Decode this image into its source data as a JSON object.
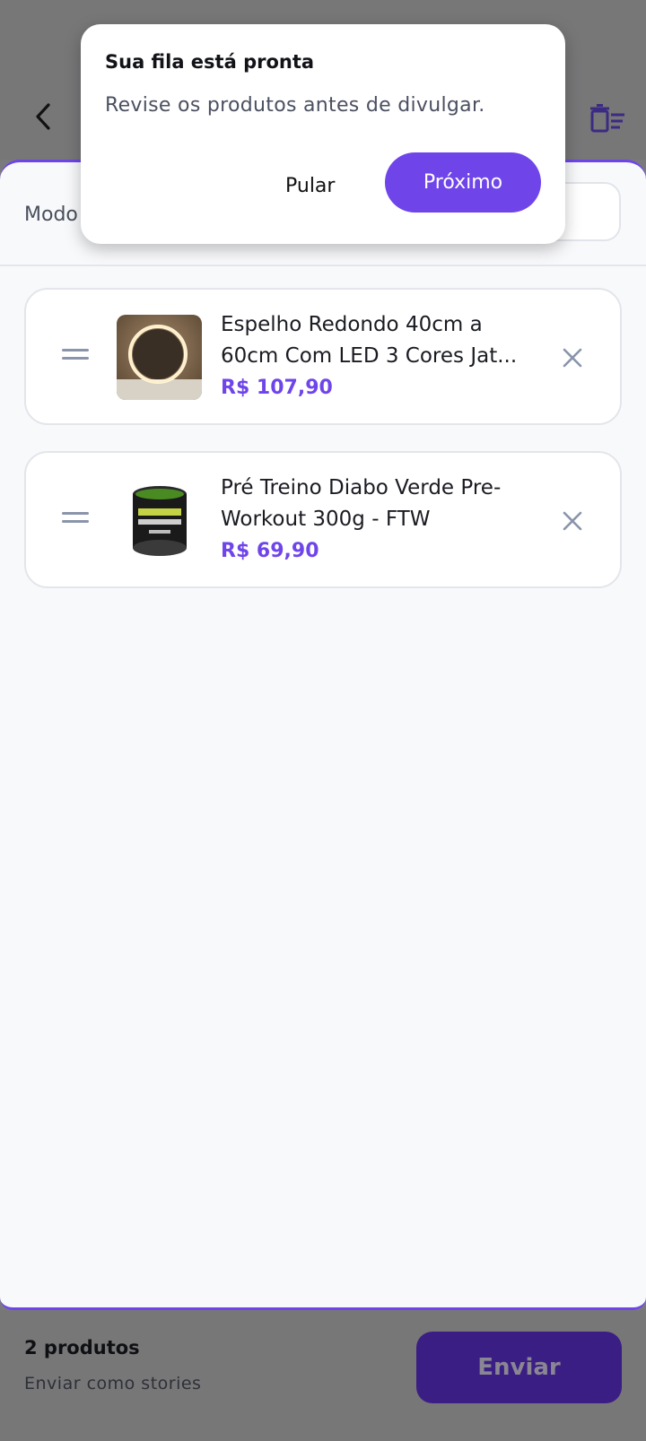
{
  "header": {
    "back_icon": "chevron-left-icon",
    "clear_icon": "clear-queue-icon"
  },
  "mode": {
    "label": "Modo"
  },
  "products": [
    {
      "title": "Espelho Redondo 40cm a 60cm Com LED 3 Cores Jat...",
      "price": "R$ 107,90",
      "thumb": "round-led-mirror-image"
    },
    {
      "title": "Pré Treino Diabo Verde Pre-Workout 300g - FTW",
      "price": "R$ 69,90",
      "thumb": "preworkout-jar-image"
    }
  ],
  "footer": {
    "count": "2 produtos",
    "send_mode": "Enviar como stories",
    "send_label": "Enviar"
  },
  "tooltip": {
    "title": "Sua fila está pronta",
    "body": "Revise os produtos antes de divulgar.",
    "skip_label": "Pular",
    "next_label": "Próximo"
  },
  "colors": {
    "accent": "#6f45ea",
    "overlay": "#7a7a7c"
  }
}
